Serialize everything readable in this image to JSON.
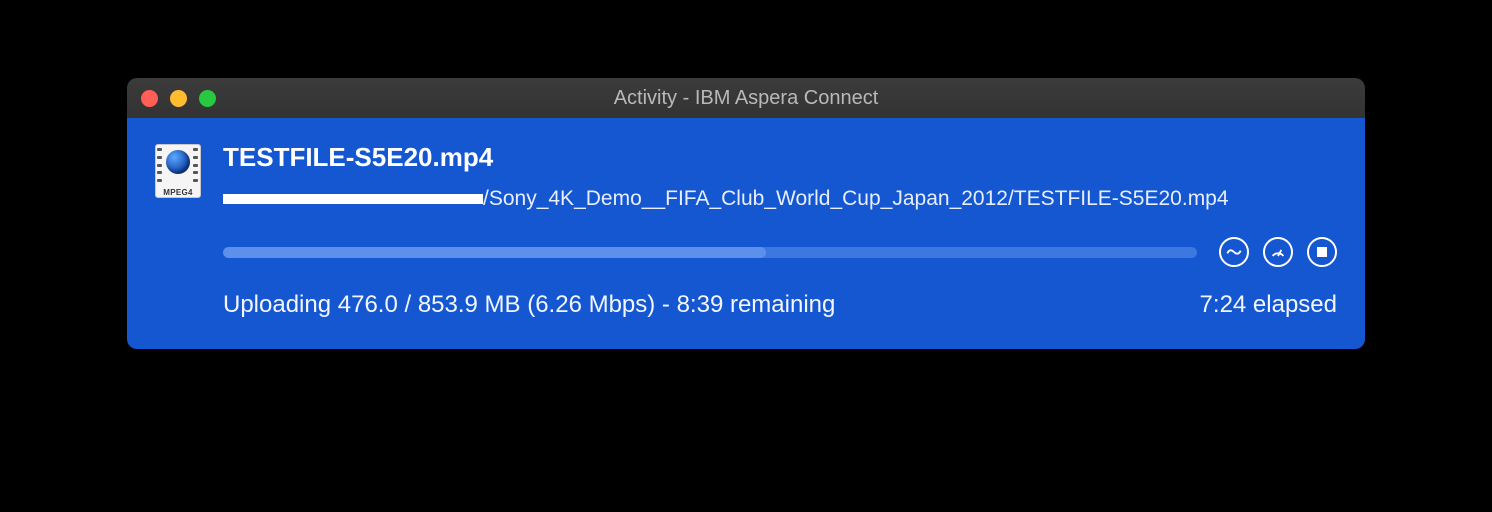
{
  "window": {
    "title": "Activity - IBM Aspera Connect"
  },
  "transfer": {
    "file_name": "TESTFILE-S5E20.mp4",
    "path_visible_suffix": "/Sony_4K_Demo__FIFA_Club_World_Cup_Japan_2012/TESTFILE-S5E20.mp4",
    "icon_label": "MPEG4",
    "progress_percent": 55.7,
    "status_text": "Uploading 476.0 / 853.9 MB (6.26 Mbps) - 8:39 remaining",
    "elapsed_text": "7:24 elapsed"
  },
  "colors": {
    "panel_bg": "#1457d1",
    "progress_track": "#3d78e0",
    "progress_fill": "#5d90ea"
  },
  "controls": {
    "chart_icon": "chart",
    "rate_icon": "rate",
    "stop_icon": "stop"
  }
}
